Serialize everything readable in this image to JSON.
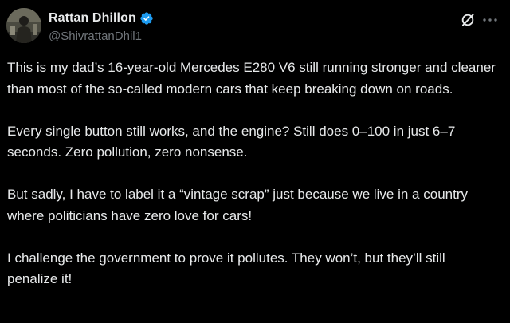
{
  "author": {
    "display_name": "Rattan Dhillon",
    "handle": "@ShivrattanDhil1",
    "verified": true
  },
  "actions": {
    "grok_icon": "grok-icon",
    "more_icon": "more-icon"
  },
  "tweet": {
    "paragraphs": [
      "This is my dad’s 16-year-old Mercedes E280 V6 still running stronger and cleaner than most of the so-called modern cars that keep breaking down on roads.",
      "Every single button still works, and the engine? Still does 0–100 in just 6–7 seconds. Zero pollution, zero nonsense.",
      "But sadly, I have to label it a “vintage scrap” just because we live in a country where politicians have zero love for cars!",
      "I challenge the government to prove it pollutes. They won’t, but they’ll still penalize it!"
    ]
  },
  "colors": {
    "background": "#000000",
    "text": "#e7e9ea",
    "secondary": "#71767b",
    "verified_badge": "#1d9bf0"
  }
}
